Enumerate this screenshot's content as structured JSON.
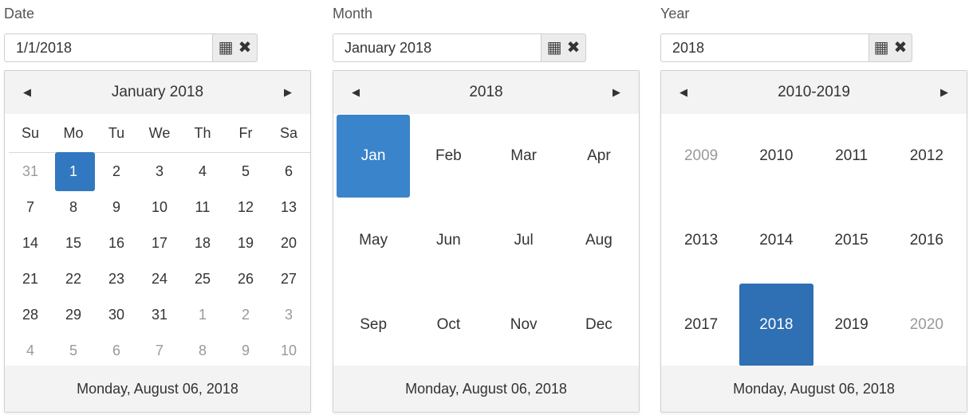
{
  "date_picker": {
    "label": "Date",
    "value": "1/1/2018",
    "header": "January 2018",
    "weekdays": [
      "Su",
      "Mo",
      "Tu",
      "We",
      "Th",
      "Fr",
      "Sa"
    ],
    "days": [
      {
        "d": "31",
        "muted": true
      },
      {
        "d": "1",
        "selected": true
      },
      {
        "d": "2"
      },
      {
        "d": "3"
      },
      {
        "d": "4"
      },
      {
        "d": "5"
      },
      {
        "d": "6"
      },
      {
        "d": "7"
      },
      {
        "d": "8"
      },
      {
        "d": "9"
      },
      {
        "d": "10"
      },
      {
        "d": "11"
      },
      {
        "d": "12"
      },
      {
        "d": "13"
      },
      {
        "d": "14"
      },
      {
        "d": "15"
      },
      {
        "d": "16"
      },
      {
        "d": "17"
      },
      {
        "d": "18"
      },
      {
        "d": "19"
      },
      {
        "d": "20"
      },
      {
        "d": "21"
      },
      {
        "d": "22"
      },
      {
        "d": "23"
      },
      {
        "d": "24"
      },
      {
        "d": "25"
      },
      {
        "d": "26"
      },
      {
        "d": "27"
      },
      {
        "d": "28"
      },
      {
        "d": "29"
      },
      {
        "d": "30"
      },
      {
        "d": "31"
      },
      {
        "d": "1",
        "muted": true
      },
      {
        "d": "2",
        "muted": true
      },
      {
        "d": "3",
        "muted": true
      },
      {
        "d": "4",
        "muted": true
      },
      {
        "d": "5",
        "muted": true
      },
      {
        "d": "6",
        "muted": true
      },
      {
        "d": "7",
        "muted": true
      },
      {
        "d": "8",
        "muted": true
      },
      {
        "d": "9",
        "muted": true
      },
      {
        "d": "10",
        "muted": true
      }
    ],
    "footer": "Monday, August 06, 2018"
  },
  "month_picker": {
    "label": "Month",
    "value": "January 2018",
    "header": "2018",
    "cells": [
      {
        "t": "Jan",
        "selected": true
      },
      {
        "t": "Feb"
      },
      {
        "t": "Mar"
      },
      {
        "t": "Apr"
      },
      {
        "t": "May"
      },
      {
        "t": "Jun"
      },
      {
        "t": "Jul"
      },
      {
        "t": "Aug"
      },
      {
        "t": "Sep"
      },
      {
        "t": "Oct"
      },
      {
        "t": "Nov"
      },
      {
        "t": "Dec"
      }
    ],
    "footer": "Monday, August 06, 2018"
  },
  "year_picker": {
    "label": "Year",
    "value": "2018",
    "header": "2010-2019",
    "cells": [
      {
        "t": "2009",
        "muted": true
      },
      {
        "t": "2010"
      },
      {
        "t": "2011"
      },
      {
        "t": "2012"
      },
      {
        "t": "2013"
      },
      {
        "t": "2014"
      },
      {
        "t": "2015"
      },
      {
        "t": "2016"
      },
      {
        "t": "2017"
      },
      {
        "t": "2018",
        "selected": true
      },
      {
        "t": "2019"
      },
      {
        "t": "2020",
        "muted": true
      }
    ],
    "footer": "Monday, August 06, 2018"
  },
  "icons": {
    "calendar": "calendar-icon",
    "clear": "clear-icon",
    "prev": "prev-arrow-icon",
    "next": "next-arrow-icon"
  },
  "colors": {
    "selected": "#3178c0",
    "header_bg": "#f3f3f3",
    "muted_text": "#9a9a9a"
  }
}
